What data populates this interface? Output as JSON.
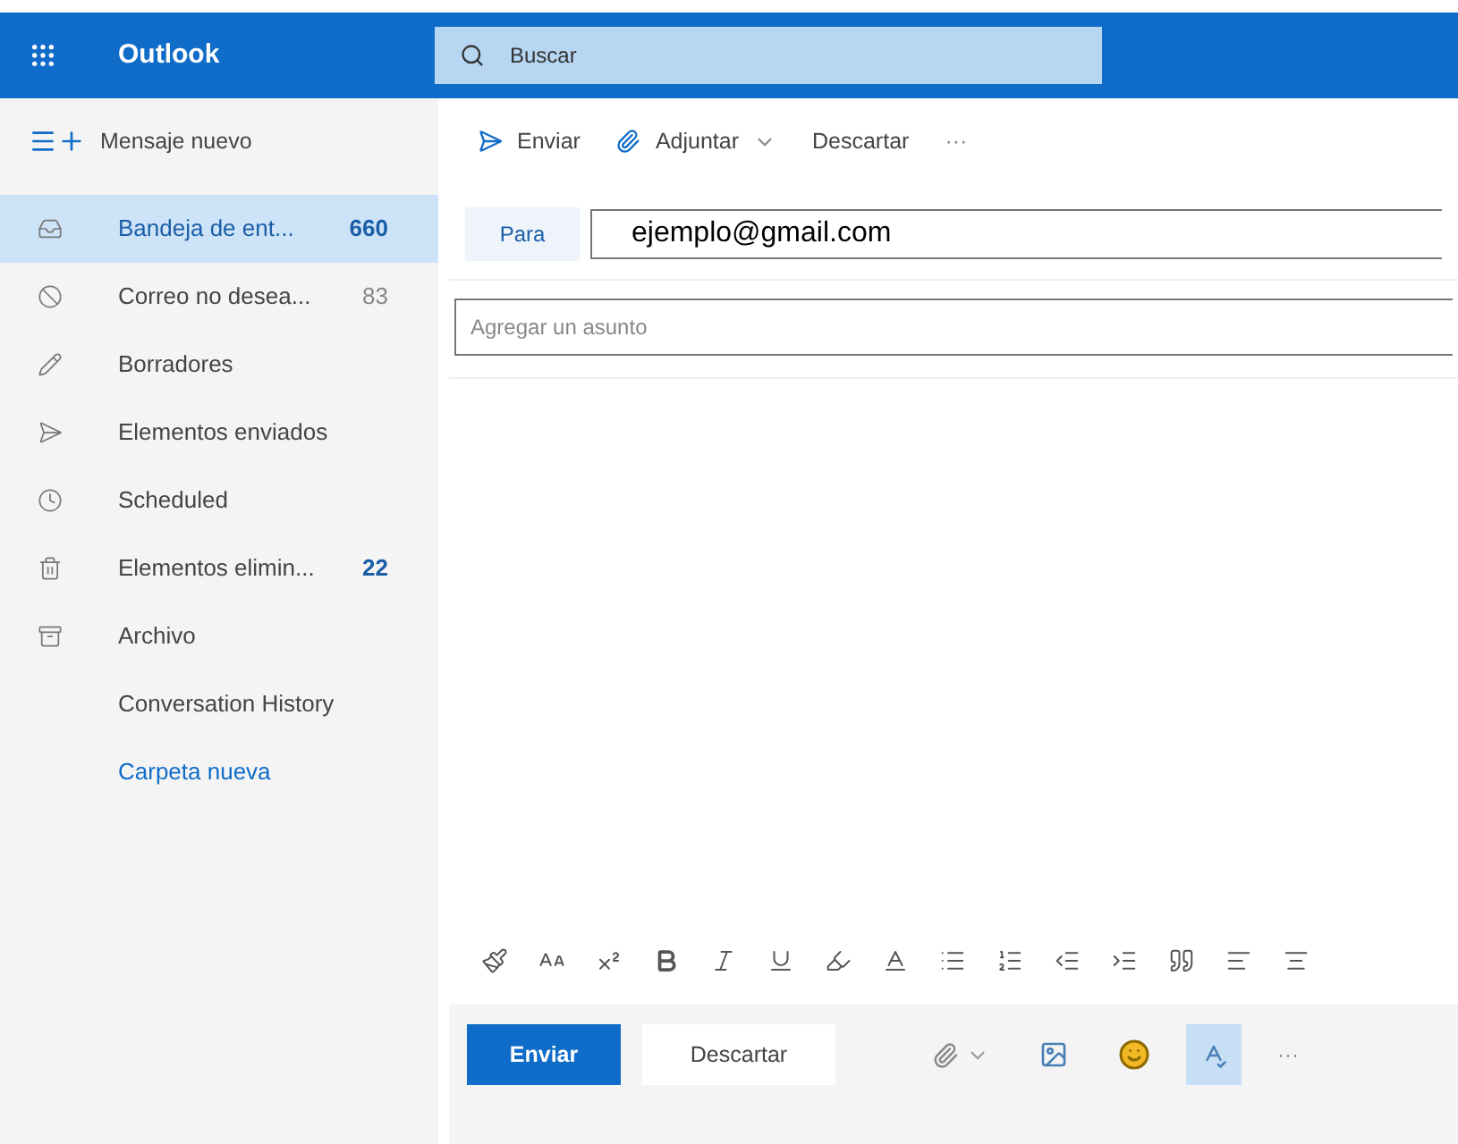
{
  "header": {
    "app_name": "Outlook",
    "search": {
      "placeholder": "Buscar"
    }
  },
  "command_bar": {
    "new_message": "Mensaje nuevo",
    "actions": [
      {
        "kind": "send",
        "label": "Enviar"
      },
      {
        "kind": "attach",
        "label": "Adjuntar"
      },
      {
        "kind": "discard",
        "label": "Descartar"
      },
      {
        "kind": "more",
        "label": "···"
      }
    ]
  },
  "sidebar": {
    "items": [
      {
        "kind": "inbox",
        "label": "Bandeja de ent...",
        "count": "660",
        "unread": true,
        "selected": true
      },
      {
        "kind": "junk",
        "label": "Correo no desea...",
        "count": "83",
        "unread": false,
        "selected": false
      },
      {
        "kind": "drafts",
        "label": "Borradores",
        "selected": false
      },
      {
        "kind": "sent",
        "label": "Elementos enviados",
        "selected": false
      },
      {
        "kind": "scheduled",
        "label": "Scheduled",
        "selected": false
      },
      {
        "kind": "deleted",
        "label": "Elementos elimin...",
        "count": "22",
        "unread": true,
        "selected": false
      },
      {
        "kind": "archive",
        "label": "Archivo",
        "selected": false
      },
      {
        "kind": "folder",
        "label": "Conversation History",
        "selected": false
      },
      {
        "kind": "link",
        "label": "Carpeta nueva",
        "selected": false
      }
    ]
  },
  "compose": {
    "to_label": "Para",
    "to_value": "ejemplo@gmail.com",
    "subject": {
      "placeholder": "Agregar un asunto"
    },
    "format_tools": [
      {
        "kind": "painter"
      },
      {
        "kind": "font-size"
      },
      {
        "kind": "superscript"
      },
      {
        "kind": "bold"
      },
      {
        "kind": "italic"
      },
      {
        "kind": "underline"
      },
      {
        "kind": "highlight"
      },
      {
        "kind": "font-color"
      },
      {
        "kind": "bullets"
      },
      {
        "kind": "numbering"
      },
      {
        "kind": "outdent"
      },
      {
        "kind": "indent"
      },
      {
        "kind": "quote"
      },
      {
        "kind": "align-left"
      },
      {
        "kind": "align-center"
      }
    ],
    "send_label": "Enviar",
    "discard_label": "Descartar",
    "bottom_tools": [
      {
        "kind": "attach",
        "on": false
      },
      {
        "kind": "image",
        "on": false
      },
      {
        "kind": "emoji",
        "on": false
      },
      {
        "kind": "editor",
        "on": true
      },
      {
        "kind": "more",
        "label": "···",
        "on": false
      }
    ]
  }
}
